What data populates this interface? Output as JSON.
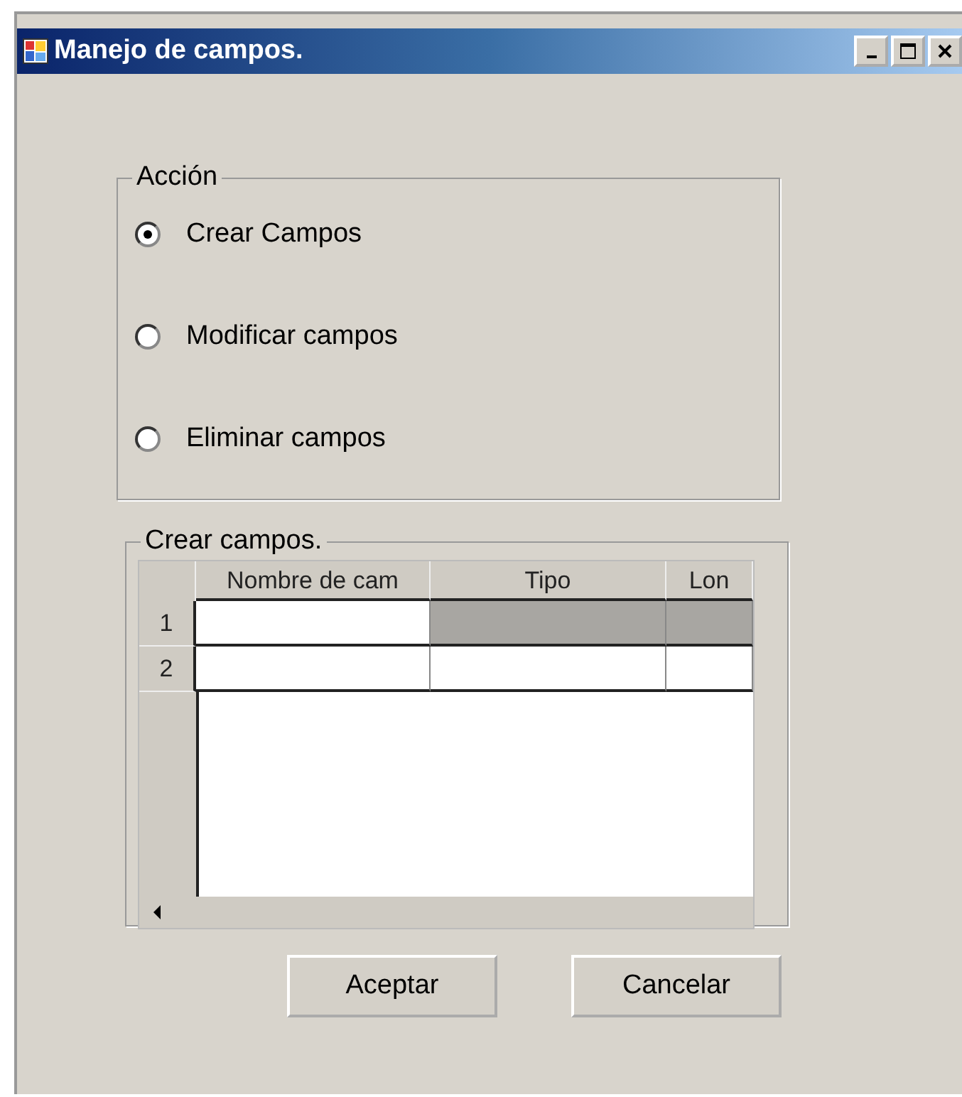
{
  "window": {
    "title": "Manejo de campos."
  },
  "action_group": {
    "label": "Acción",
    "options": [
      {
        "label": "Crear Campos",
        "selected": true
      },
      {
        "label": "Modificar campos",
        "selected": false
      },
      {
        "label": "Eliminar campos",
        "selected": false
      }
    ]
  },
  "fields_group": {
    "label": "Crear campos.",
    "table": {
      "columns": [
        "Nombre de cam",
        "Tipo",
        "Lon"
      ],
      "rows": [
        {
          "header": "1",
          "cells": [
            {
              "selected": false
            },
            {
              "selected": true
            },
            {
              "selected": true
            }
          ]
        },
        {
          "header": "2",
          "cells": [
            {
              "selected": false
            },
            {
              "selected": false
            },
            {
              "selected": false
            }
          ]
        }
      ]
    }
  },
  "buttons": [
    "Aceptar",
    "Cancelar"
  ]
}
